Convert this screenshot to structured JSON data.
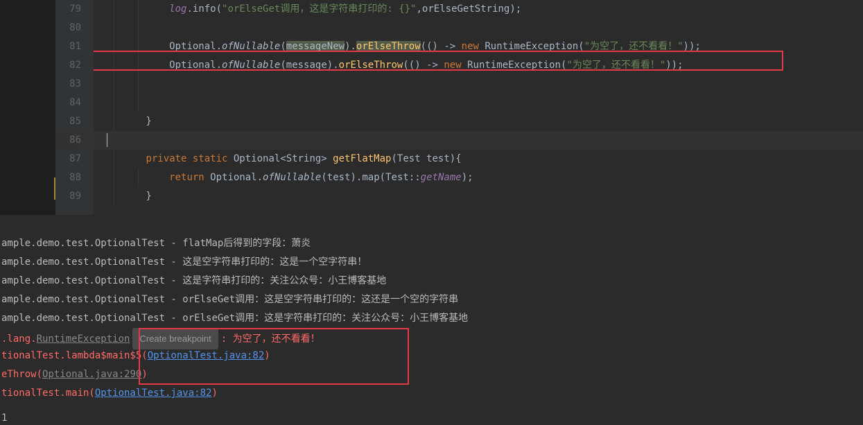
{
  "gutter": {
    "start": 79,
    "end": 89
  },
  "code": {
    "l79": {
      "p1": "            ",
      "log": "log",
      "dot": ".",
      "info": "info",
      "open": "(",
      "s": "\"orElseGet调用，这是字符串打印的: {}\"",
      "comma": ",",
      "arg": "orElseGetString",
      "close": ");"
    },
    "l80": {
      "blank": ""
    },
    "l81": {
      "pad": "            ",
      "opt": "Optional",
      "dot": ".",
      "of": "ofNullable",
      "o": "(",
      "arg": "messageNew",
      "c": ").",
      "meth": "orElseThrow",
      "o2": "(() -> ",
      "new": "new ",
      "ex": "RuntimeException",
      "o3": "(",
      "s": "\"为空了，还不看看！\"",
      "end": "));"
    },
    "l82": {
      "pad": "            ",
      "opt": "Optional",
      "dot": ".",
      "of": "ofNullable",
      "o": "(",
      "arg": "message",
      "c": ").",
      "meth": "orElseThrow",
      "o2": "(() -> ",
      "new": "new ",
      "ex": "RuntimeException",
      "o3": "(",
      "s": "\"为空了，还不看看！\"",
      "end": "));"
    },
    "l83": {
      "blank": ""
    },
    "l84": {
      "blank": ""
    },
    "l85": {
      "brace": "        }"
    },
    "l86": {
      "blank": "    "
    },
    "l87": {
      "pad": "        ",
      "priv": "private static ",
      "type": "Optional<String> ",
      "name": "getFlatMap",
      "o": "(",
      "ptype": "Test ",
      "pname": "test",
      "c": "){"
    },
    "l88": {
      "pad": "            ",
      "ret": "return ",
      "opt": "Optional",
      "dot": ".",
      "of": "ofNullable",
      "o": "(",
      "arg": "test",
      "c": ").",
      "map": "map",
      "o2": "(",
      "ref": "Test",
      "cc": "::",
      "gn": "getName",
      "end": ");"
    },
    "l89": {
      "brace": "        }"
    }
  },
  "console": {
    "l1": {
      "prefix": "ample.demo.test.OptionalTest - ",
      "msg": "flatMap后得到的字段：萧炎"
    },
    "l2": {
      "prefix": "ample.demo.test.OptionalTest - ",
      "msg": "这是空字符串打印的：这是一个空字符串！"
    },
    "l3": {
      "prefix": "ample.demo.test.OptionalTest - ",
      "msg": "这是字符串打印的：关注公众号：小王博客基地"
    },
    "l4": {
      "prefix": "ample.demo.test.OptionalTest - ",
      "msg": "orElseGet调用：这是空字符串打印的：这还是一个空的字符串"
    },
    "l5": {
      "prefix": "ample.demo.test.OptionalTest - ",
      "msg": "orElseGet调用：这是字符串打印的：关注公众号：小王博客基地"
    },
    "l6": {
      "p1": ".lang.",
      "ex": "RuntimeException",
      "bp": "Create breakpoint",
      "colon": ": ",
      "msg": "为空了，还不看看！"
    },
    "l7": {
      "p1": "tionalTest.lambda$main$5(",
      "link": "OptionalTest.java:82",
      "end": ")"
    },
    "l8": {
      "p1": "eThrow(",
      "link": "Optional.java:290",
      "end": ")"
    },
    "l9": {
      "p1": "tionalTest.main(",
      "link": "OptionalTest.java:82",
      "end": ")"
    },
    "footer": "1"
  }
}
